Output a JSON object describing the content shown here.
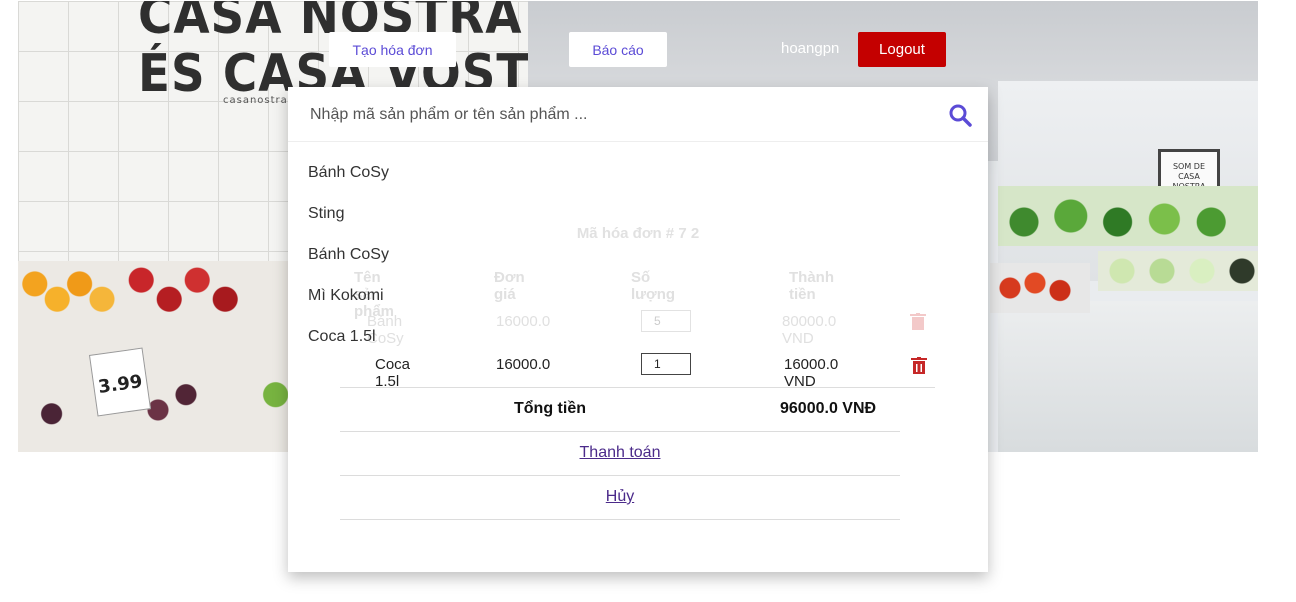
{
  "nav": {
    "create_invoice": "Tạo hóa đơn",
    "report": "Báo cáo",
    "username": "hoangpn",
    "logout": "Logout"
  },
  "hero": {
    "brand_line1": "CASA NOSTRA",
    "brand_line2": "ÉS CASA VOSTRA",
    "brand_small": "casanostra",
    "price_tag": "3.99",
    "sign_text": "SOM DE CASA NOSTRA"
  },
  "search": {
    "placeholder": "Nhập mã sản phẩm or tên sản phẩm ...",
    "icon": "search-icon",
    "suggestions": [
      "Bánh CoSy",
      "Sting",
      "Bánh CoSy",
      "Mì Kokomi",
      "Coca 1.5l"
    ]
  },
  "invoice": {
    "title": "Mã hóa đơn # 7 2",
    "headers": [
      "Tên sản phẩm",
      "Đơn giá",
      "Số lượng",
      "Thành tiền"
    ],
    "rows": [
      {
        "name": "Bánh CoSy",
        "price": "16000.0",
        "qty": "5",
        "total": "80000.0 VND"
      },
      {
        "name": "Coca 1.5l",
        "price": "16000.0",
        "qty": "1",
        "total": "16000.0 VND"
      }
    ],
    "total_label": "Tổng tiền",
    "total_value": "96000.0 VNĐ",
    "pay_label": "Thanh toán",
    "cancel_label": "Hủy"
  },
  "colors": {
    "accent": "#5b4bd6",
    "logout": "#c40000",
    "delete": "#c62828"
  }
}
